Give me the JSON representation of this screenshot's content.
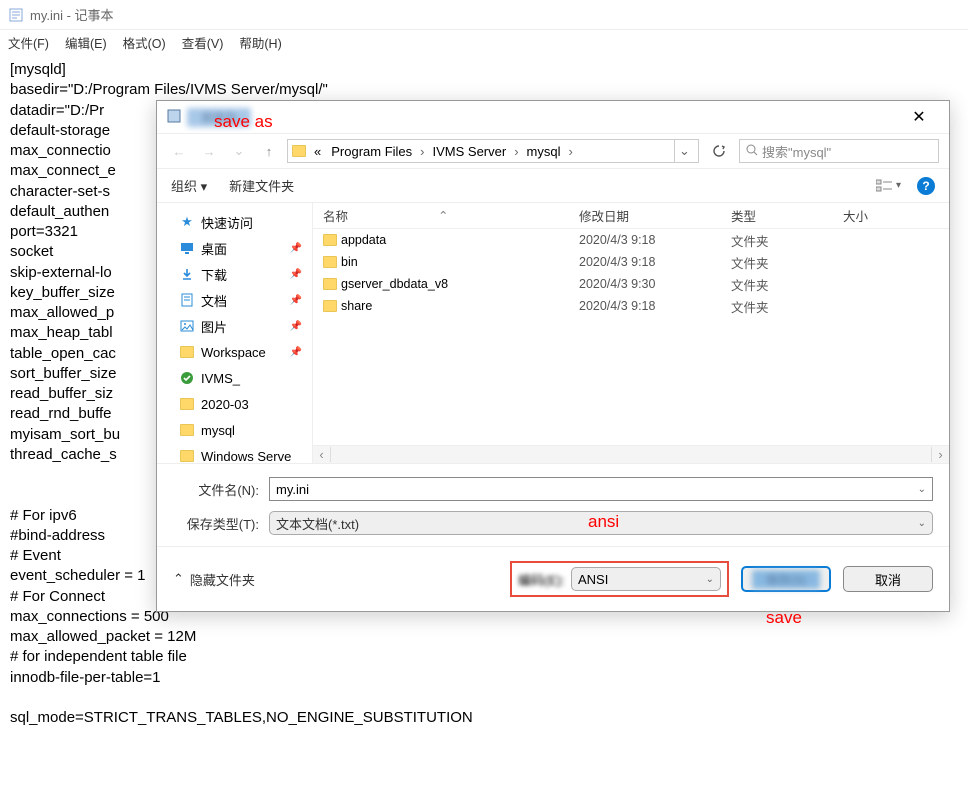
{
  "notepad": {
    "title": "my.ini - 记事本",
    "menu": [
      "文件(F)",
      "编辑(E)",
      "格式(O)",
      "查看(V)",
      "帮助(H)"
    ],
    "content": "[mysqld]\nbasedir=\"D:/Program Files/IVMS Server/mysql/\"\ndatadir=\"D:/Pr\ndefault-storage\nmax_connectio\nmax_connect_e\ncharacter-set-s\ndefault_authen\nport=3321\nsocket\nskip-external-lo\nkey_buffer_size\nmax_allowed_p\nmax_heap_tabl\ntable_open_cac\nsort_buffer_size\nread_buffer_siz\nread_rnd_buffe\nmyisam_sort_bu\nthread_cache_s\n\n\n# For ipv6\n#bind-address\n# Event\nevent_scheduler = 1\n# For Connect\nmax_connections = 500\nmax_allowed_packet = 12M\n# for independent table file\ninnodb-file-per-table=1\n\nsql_mode=STRICT_TRANS_TABLES,NO_ENGINE_SUBSTITUTION"
  },
  "dialog": {
    "title_blur": "另存为",
    "breadcrumb_prefix": "«",
    "breadcrumb": [
      "Program Files",
      "IVMS Server",
      "mysql"
    ],
    "search_placeholder": "搜索\"mysql\"",
    "toolbar": {
      "organize": "组织 ▾",
      "new_folder": "新建文件夹"
    },
    "columns": {
      "name": "名称",
      "date": "修改日期",
      "type": "类型",
      "size": "大小"
    },
    "sidebar": [
      {
        "label": "快速访问",
        "icon": "star",
        "color": "#2a8cda"
      },
      {
        "label": "桌面",
        "icon": "desktop",
        "color": "#2a8cda",
        "pin": true
      },
      {
        "label": "下载",
        "icon": "download",
        "color": "#2a8cda",
        "pin": true
      },
      {
        "label": "文档",
        "icon": "doc",
        "color": "#2a8cda",
        "pin": true
      },
      {
        "label": "图片",
        "icon": "image",
        "color": "#2a8cda",
        "pin": true
      },
      {
        "label": "Workspace",
        "icon": "folder",
        "pin": true
      },
      {
        "label": "IVMS_",
        "icon": "check"
      },
      {
        "label": "2020-03",
        "icon": "folder"
      },
      {
        "label": "mysql",
        "icon": "folder"
      },
      {
        "label": "Windows Serve",
        "icon": "folder"
      }
    ],
    "files": [
      {
        "name": "appdata",
        "date": "2020/4/3 9:18",
        "type": "文件夹"
      },
      {
        "name": "bin",
        "date": "2020/4/3 9:18",
        "type": "文件夹"
      },
      {
        "name": "gserver_dbdata_v8",
        "date": "2020/4/3 9:30",
        "type": "文件夹"
      },
      {
        "name": "share",
        "date": "2020/4/3 9:18",
        "type": "文件夹"
      }
    ],
    "filename_label": "文件名(N):",
    "filename_value": "my.ini",
    "savetype_label": "保存类型(T):",
    "savetype_value": "文本文档(*.txt)",
    "hide_folders": "隐藏文件夹",
    "encoding_label": "编码(E):",
    "encoding_value": "ANSI",
    "save_blur": "保存(S)",
    "cancel": "取消"
  },
  "annotations": {
    "saveas": "save as",
    "ansi": "ansi",
    "save": "save"
  }
}
